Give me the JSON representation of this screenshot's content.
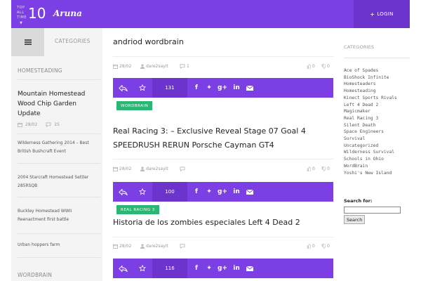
{
  "header": {
    "top_all_line1": "TOP",
    "top_all_line2": "ALL",
    "top_all_line3": "TIME",
    "top_number": "10",
    "logo": "Aruna",
    "login_label": "LOGIN",
    "colors": {
      "accent": "#7b3fe4",
      "accent_dark": "#6c34cd",
      "tag_green": "#2bb673"
    }
  },
  "left_sidebar": {
    "categories_label": "CATEGORIES",
    "section_homesteading": "HOMESTEADING",
    "featured": {
      "title": "Mountain Homestead Wood Chip Garden Update",
      "date": "28/02",
      "comments": "25"
    },
    "links": [
      "Wilderness Gathering 2014 – Best British Bushcraft Event",
      "2004 Starcraft Homestead Settler 285RSQB",
      "Buckley Homestead WWII Reenactment first battle",
      "Urban hoppers farm"
    ],
    "section_wordbrain": "WORDBRAIN"
  },
  "main": {
    "page_title": "andriod wordbrain",
    "posts": [
      {
        "date": "28/02",
        "author": "dare2sayit",
        "comments": "1",
        "likes": "0",
        "dislikes": "0",
        "shares": "131",
        "tag": "WORDBRAIN"
      },
      {
        "title_line1": "Real Racing 3: – Exclusive Reveal Stage 07 Goal 4",
        "title_line2": "SPEEDRUSH RERUN Porsche Cayman GT4",
        "date": "28/02",
        "author": "dare2sayit",
        "likes": "0",
        "dislikes": "0",
        "shares": "100",
        "tag": "REAL RACING 3"
      },
      {
        "title": "Historia de los zombies especiales Left 4 Dead 2",
        "date": "28/02",
        "author": "dare2sayit",
        "likes": "0",
        "dislikes": "0",
        "shares": "116"
      }
    ]
  },
  "right_sidebar": {
    "categories_label": "CATEGORIES",
    "categories": [
      "Ace of Spades",
      "BioShock Infinite",
      "Homesteaders",
      "Homesteading",
      "Kinect Sports Rivals",
      "Left 4 Dead 2",
      "Magicmaker",
      "Real Racing 3",
      "Silent Death",
      "Space Engineers",
      "Survival",
      "Uncategorized",
      "Wilderness Survival",
      "Schools in Ohio",
      "WordBrain",
      "Yoshi's New Island"
    ],
    "search_label": "Search for:",
    "search_button": "Search"
  }
}
